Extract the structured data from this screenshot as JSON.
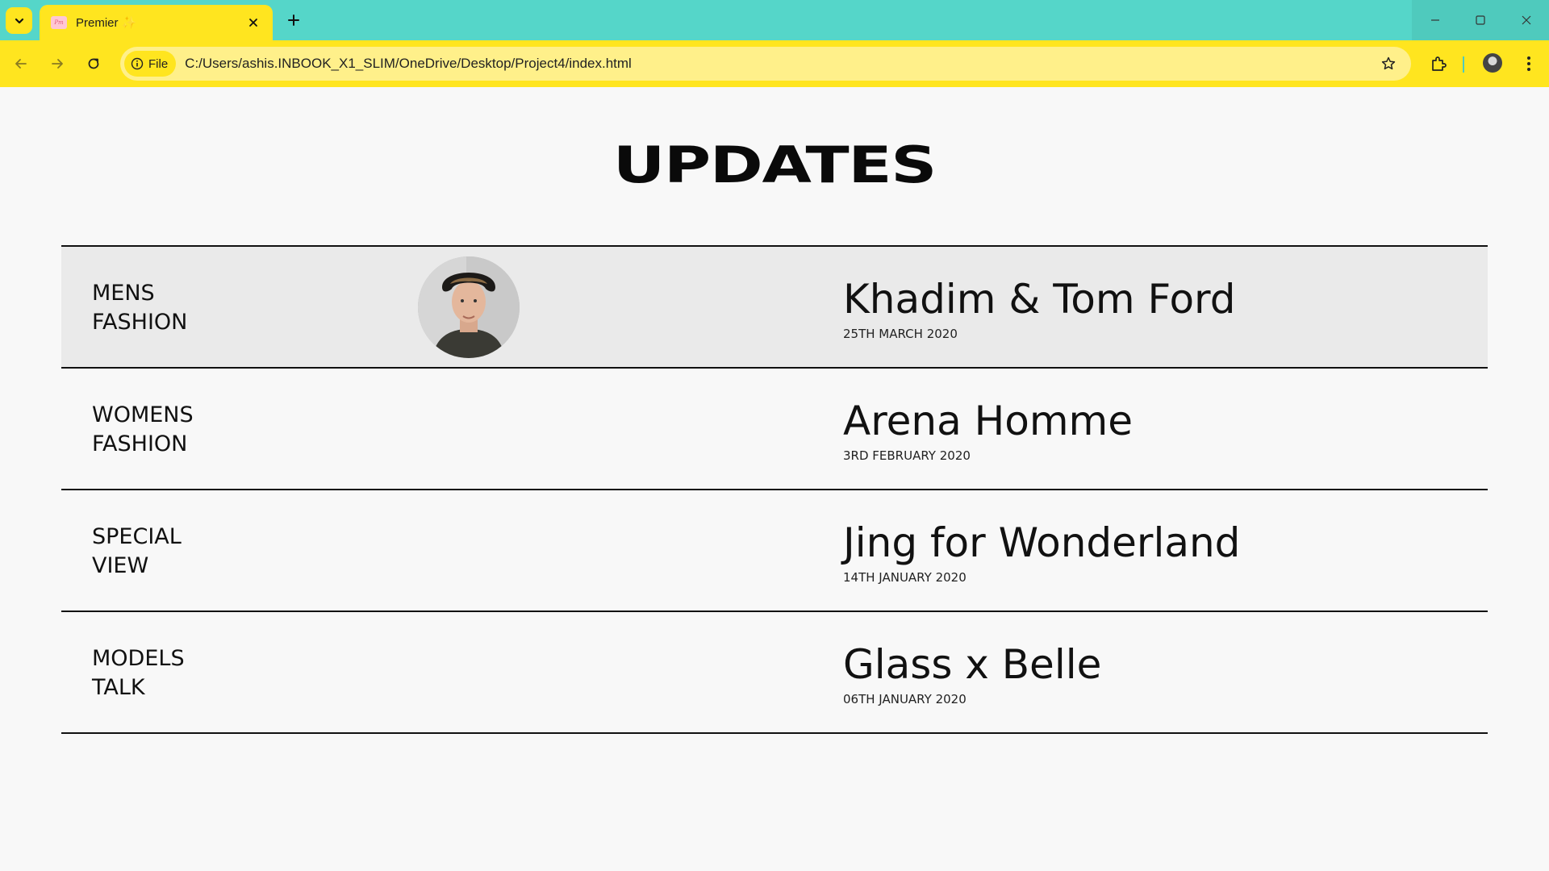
{
  "browser": {
    "tab_title": "Premier ✨",
    "favicon_text": "Pm",
    "address_chip": "File",
    "url": "C:/Users/ashis.INBOOK_X1_SLIM/OneDrive/Desktop/Project4/index.html",
    "colors": {
      "tabstrip": "#55d6c9",
      "toolbar": "#ffe51f",
      "omnibox": "#fff08a"
    }
  },
  "page": {
    "heading": "UPDATES",
    "items": [
      {
        "category_line1": "MENS",
        "category_line2": "FASHION",
        "title": "Khadim & Tom Ford",
        "date": "25TH MARCH 2020",
        "active": true
      },
      {
        "category_line1": "WOMENS",
        "category_line2": "FASHION",
        "title": "Arena Homme",
        "date": "3RD FEBRUARY 2020",
        "active": false
      },
      {
        "category_line1": "SPECIAL",
        "category_line2": "VIEW",
        "title": "Jing for Wonderland",
        "date": "14TH JANUARY 2020",
        "active": false
      },
      {
        "category_line1": "MODELS",
        "category_line2": "TALK",
        "title": "Glass x Belle",
        "date": "06TH JANUARY 2020",
        "active": false
      }
    ]
  }
}
